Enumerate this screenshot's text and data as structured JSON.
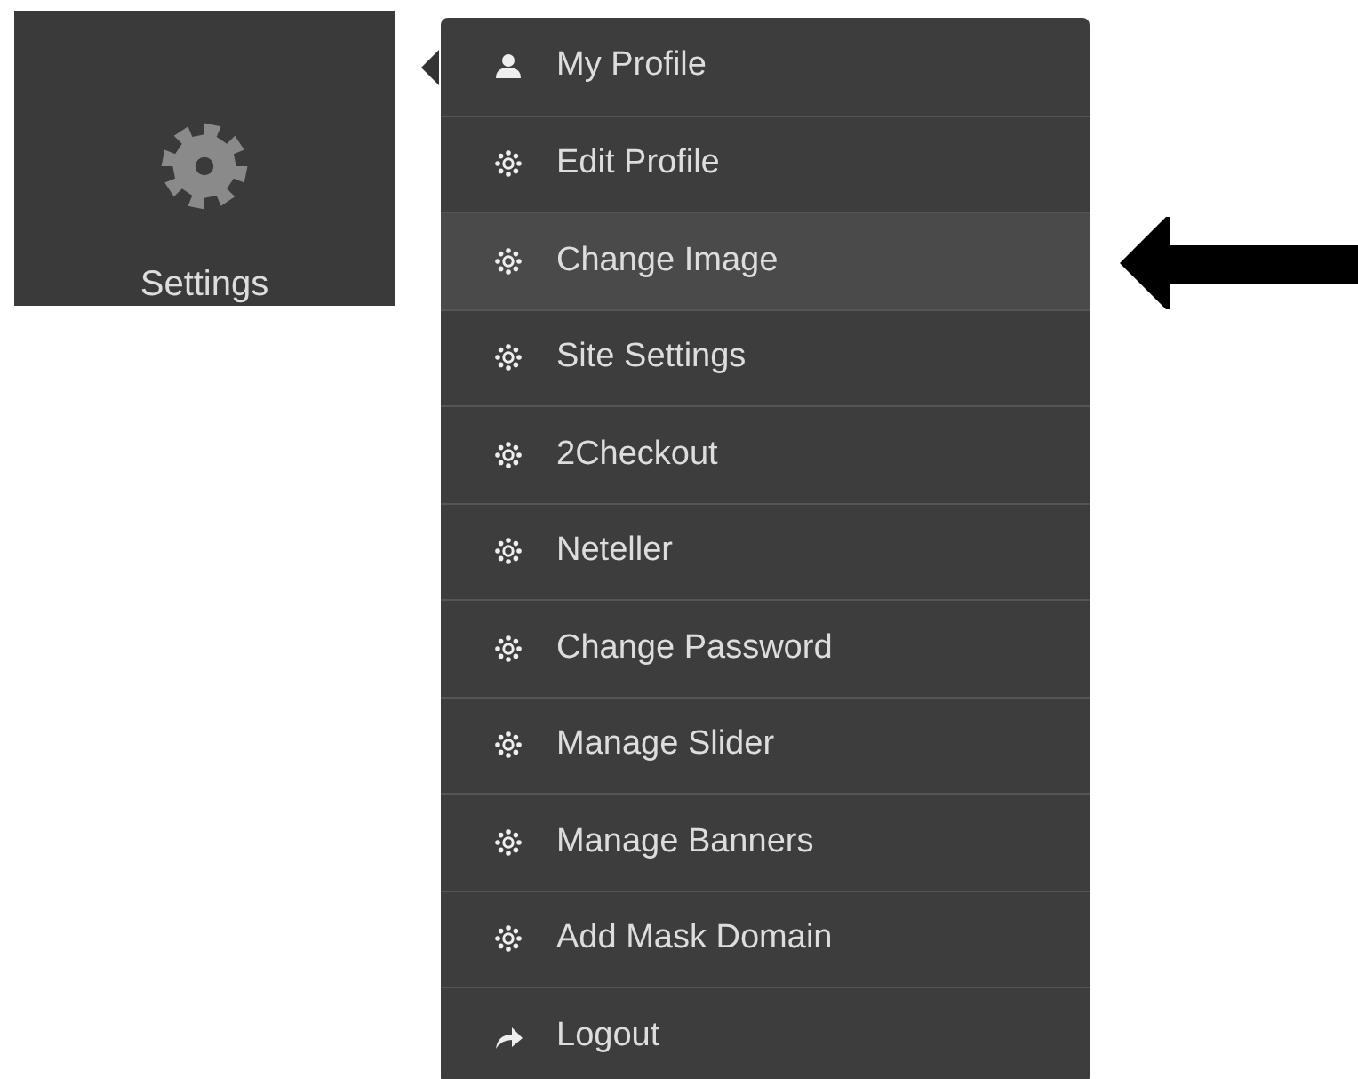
{
  "tile": {
    "label": "Settings"
  },
  "menu": {
    "items": [
      {
        "label": "My Profile",
        "kind": "user",
        "selected": false
      },
      {
        "label": "Edit Profile",
        "kind": "gear",
        "selected": false
      },
      {
        "label": "Change Image",
        "kind": "gear",
        "selected": true
      },
      {
        "label": "Site Settings",
        "kind": "gear",
        "selected": false
      },
      {
        "label": "2Checkout",
        "kind": "gear",
        "selected": false
      },
      {
        "label": "Neteller",
        "kind": "gear",
        "selected": false
      },
      {
        "label": "Change Password",
        "kind": "gear",
        "selected": false
      },
      {
        "label": "Manage Slider",
        "kind": "gear",
        "selected": false
      },
      {
        "label": "Manage Banners",
        "kind": "gear",
        "selected": false
      },
      {
        "label": "Add Mask Domain",
        "kind": "gear",
        "selected": false
      },
      {
        "label": "Logout",
        "kind": "logout",
        "selected": false
      }
    ]
  }
}
